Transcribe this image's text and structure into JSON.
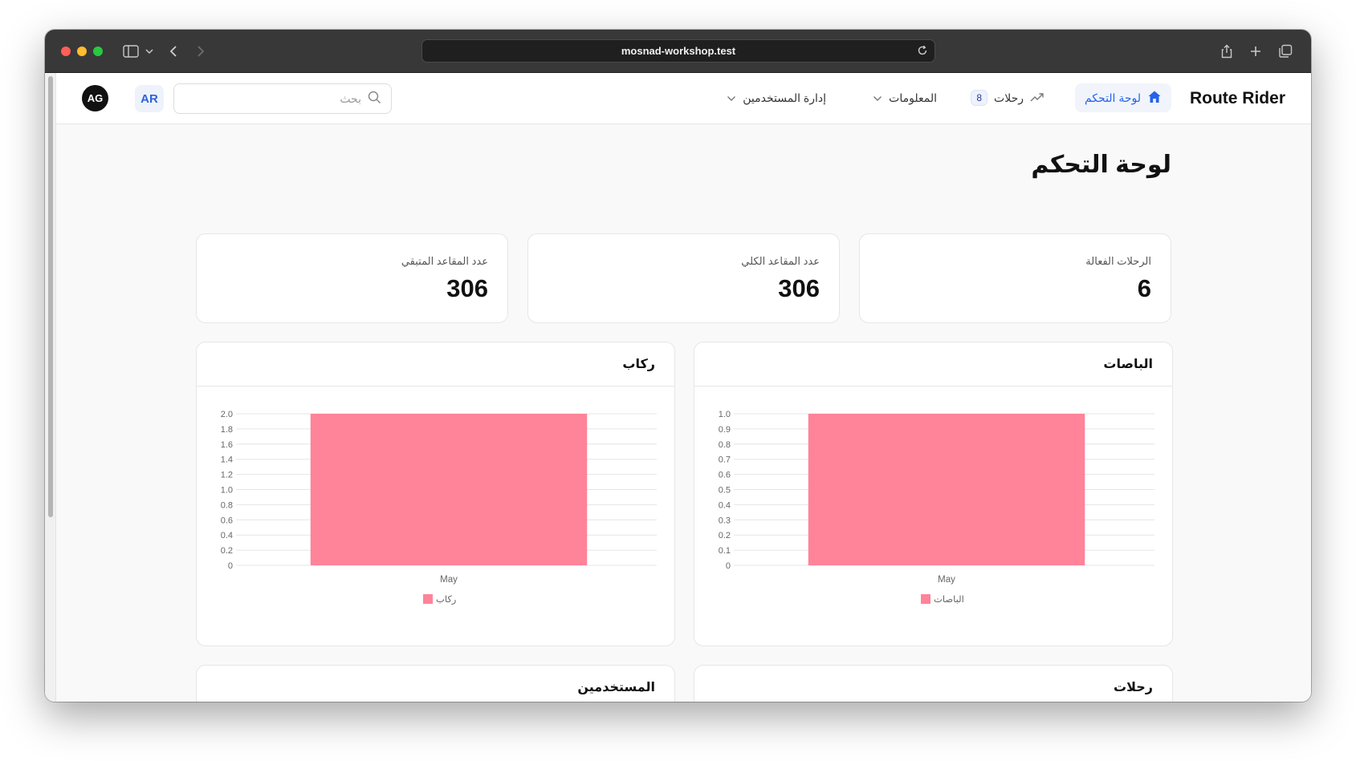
{
  "browser": {
    "url": "mosnad-workshop.test"
  },
  "nav": {
    "brand": "Route Rider",
    "dashboard": "لوحة التحكم",
    "trips": "رحلات",
    "trips_badge": "8",
    "info": "المعلومات",
    "users": "إدارة المستخدمين",
    "search_placeholder": "بحث",
    "lang": "AR",
    "avatar": "AG"
  },
  "page": {
    "title": "لوحة التحكم"
  },
  "stats": [
    {
      "label": "الرحلات الفعالة",
      "value": "6"
    },
    {
      "label": "عدد المقاعد الكلي",
      "value": "306"
    },
    {
      "label": "عدد المقاعد المتبقي",
      "value": "306"
    }
  ],
  "panels": {
    "buses_title": "الباصات",
    "passengers_title": "ركاب",
    "trips_title": "رحلات",
    "users_title": "المستخدمين"
  },
  "colors": {
    "bar": "#ff8399",
    "accent": "#2563eb"
  },
  "chart_data": [
    {
      "type": "bar",
      "title": "الباصات",
      "categories": [
        "May"
      ],
      "series": [
        {
          "name": "الباصات",
          "values": [
            1
          ]
        }
      ],
      "ylim": [
        0,
        1
      ],
      "yticks": [
        0,
        0.1,
        0.2,
        0.3,
        0.4,
        0.5,
        0.6,
        0.7,
        0.8,
        0.9,
        1.0
      ],
      "ytick_labels": [
        "0",
        "0.1",
        "0.2",
        "0.3",
        "0.4",
        "0.5",
        "0.6",
        "0.7",
        "0.8",
        "0.9",
        "1.0"
      ],
      "grid": true,
      "legend": "bottom"
    },
    {
      "type": "bar",
      "title": "ركاب",
      "categories": [
        "May"
      ],
      "series": [
        {
          "name": "ركاب",
          "values": [
            2
          ]
        }
      ],
      "ylim": [
        0,
        2
      ],
      "yticks": [
        0,
        0.2,
        0.4,
        0.6,
        0.8,
        1.0,
        1.2,
        1.4,
        1.6,
        1.8,
        2.0
      ],
      "ytick_labels": [
        "0",
        "0.2",
        "0.4",
        "0.6",
        "0.8",
        "1.0",
        "1.2",
        "1.4",
        "1.6",
        "1.8",
        "2.0"
      ],
      "grid": true,
      "legend": "bottom"
    }
  ]
}
